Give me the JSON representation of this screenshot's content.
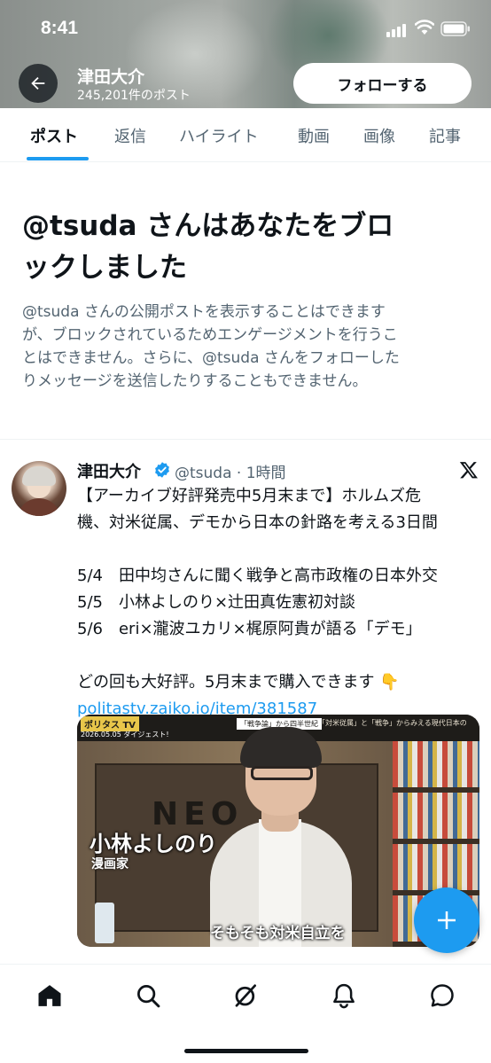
{
  "status_bar": {
    "time": "8:41"
  },
  "header": {
    "name": "津田大介",
    "post_count": "245,201件のポスト",
    "follow_label": "フォローする"
  },
  "tabs": [
    {
      "label": "ポスト",
      "active": true
    },
    {
      "label": "返信"
    },
    {
      "label": "ハイライト"
    },
    {
      "label": "動画"
    },
    {
      "label": "画像"
    },
    {
      "label": "記事"
    }
  ],
  "blocked": {
    "title_lines": [
      "@tsuda さんはあなたをブロ",
      "ックしました"
    ],
    "desc_lines": [
      "@tsuda さんの公開ポストを表示することはできます",
      "が、ブロックされているためエンゲージメントを行うこ",
      "とはできません。さらに、@tsuda さんをフォローした",
      "りメッセージを送信したりすることもできません。"
    ]
  },
  "tweet": {
    "name": "津田大介",
    "handle_time": "@tsuda · 1時間",
    "lines": [
      "【アーカイブ好評発売中5月末まで】ホルムズ危",
      "機、対米従属、デモから日本の針路を考える3日間",
      "",
      "5/4　田中均さんに聞く戦争と高市政権の日本外交",
      "5/5　小林よしのり×辻田真佐憲初対談",
      "5/6　eri×瀧波ユカリ×梶原阿貴が語る「デモ」",
      "",
      "どの回も大好評。5月末まで購入できます 👇"
    ],
    "link": "politastv.zaiko.io/item/381587",
    "media": {
      "logo": "ポリタス TV",
      "date": "2026.05.05 ダイジェスト!",
      "banner1": "「戦争論」から四半世紀",
      "banner2": "「対米従属」と「戦争」からみえる現代日本の",
      "sign": "NEO",
      "name": "小林よしのり",
      "role": "漫画家",
      "caption": "そもそも対米自立を"
    }
  },
  "colors": {
    "accent": "#1d9bf0",
    "text": "#0f1419",
    "secondary": "#536471"
  },
  "nav": [
    "home-icon",
    "search-icon",
    "grok-icon",
    "notifications-icon",
    "messages-icon"
  ]
}
